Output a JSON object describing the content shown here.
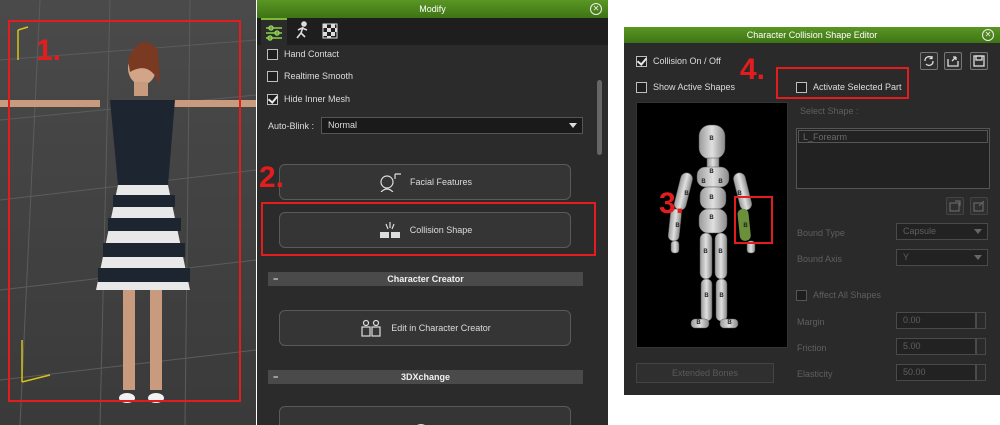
{
  "annotations": {
    "n1": "1.",
    "n2": "2.",
    "n3": "3.",
    "n4": "4."
  },
  "modify": {
    "title": "Modify",
    "options": [
      {
        "label": "Hand Contact",
        "checked": false
      },
      {
        "label": "Realtime Smooth",
        "checked": false
      },
      {
        "label": "Hide Inner Mesh",
        "checked": true
      }
    ],
    "auto_blink_label": "Auto-Blink :",
    "auto_blink_value": "Normal",
    "facial_features": "Facial Features",
    "collision_shape": "Collision Shape",
    "section_cc": "Character Creator",
    "edit_cc": "Edit in Character Creator",
    "section_3dx": "3DXchange",
    "section_toggle": "−"
  },
  "editor": {
    "title": "Character Collision Shape Editor",
    "collision_onoff": "Collision On / Off",
    "show_active": "Show Active Shapes",
    "activate_selected": "Activate Selected Part",
    "select_shape": "Select Shape :",
    "selected_item": "L_Forearm",
    "bound_type_label": "Bound Type",
    "bound_type_value": "Capsule",
    "bound_axis_label": "Bound Axis",
    "bound_axis_value": "Y",
    "affect_all": "Affect All Shapes",
    "margin_label": "Margin",
    "margin_value": "0.00",
    "friction_label": "Friction",
    "friction_value": "5.00",
    "elasticity_label": "Elasticity",
    "elasticity_value": "50.00",
    "extended_bones": "Extended Bones",
    "bone_marker": "B"
  },
  "colors": {
    "accent_green": "#5a9624",
    "annotation_red": "#e31d1d"
  }
}
